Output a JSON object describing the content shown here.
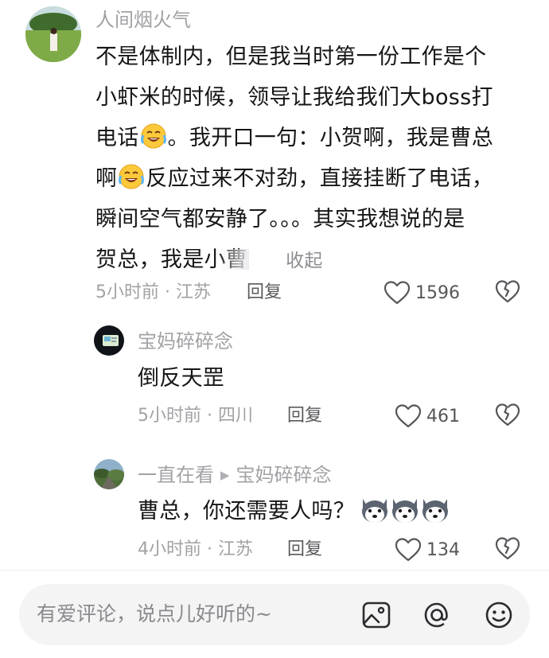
{
  "comments": [
    {
      "username": "人间烟火气",
      "lines": [
        "不是体制内，但是我当时第一份工作是个",
        "小虾米的时候，领导让我给我们大boss打",
        "电话",
        "。我开口一句：小贺啊，我是曹总",
        "啊",
        "反应过来不对劲，直接挂断了电话，",
        "瞬间空气都安静了。。。其实我想说的是",
        "贺总，我是小曹"
      ],
      "collapse_label": "收起",
      "time_location": "5小时前 · 江苏",
      "reply_label": "回复",
      "likes": "1596",
      "emoji": "laugh-cry-emoji"
    },
    {
      "username": "宝妈碎碎念",
      "text": "倒反天罡",
      "time_location": "5小时前 · 四川",
      "reply_label": "回复",
      "likes": "461"
    },
    {
      "username": "一直在看",
      "reply_to": "宝妈碎碎念",
      "text": "曹总，你还需要人吗？",
      "time_location": "4小时前 · 江苏",
      "reply_label": "回复",
      "likes": "134",
      "emoji": "husky-dog-emoji"
    }
  ],
  "input": {
    "placeholder": "有爱评论，说点儿好听的~"
  },
  "icons": [
    "heart-icon",
    "dislike-heart-icon",
    "image-icon",
    "at-icon",
    "emoji-icon",
    "reply-arrow-icon"
  ],
  "colors": {
    "text": "#161616",
    "meta": "#a2a2a6",
    "input_bg": "#f4f4f5"
  }
}
